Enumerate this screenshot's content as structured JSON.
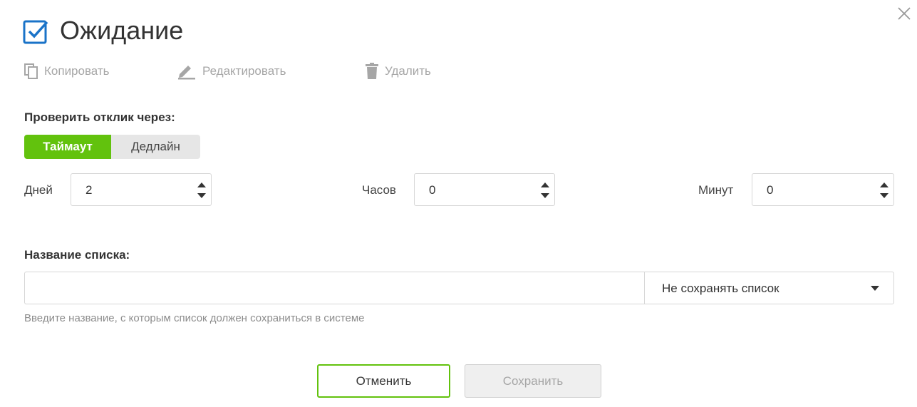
{
  "dialog": {
    "title": "Ожидание",
    "close_icon": "close-icon",
    "title_icon": "checkbox-checked-icon",
    "accent": "#62c20d",
    "brand_blue": "#1a73c8"
  },
  "toolbar": {
    "copy_label": "Копировать",
    "edit_label": "Редактировать",
    "delete_label": "Удалить"
  },
  "response_check": {
    "label": "Проверить отклик через:",
    "options": [
      "Таймаут",
      "Дедлайн"
    ],
    "selected": "Таймаут"
  },
  "timeout": {
    "days_label": "Дней",
    "days_value": "2",
    "hours_label": "Часов",
    "hours_value": "0",
    "minutes_label": "Минут",
    "minutes_value": "0"
  },
  "list_name": {
    "label": "Название списка:",
    "value": "",
    "select_value": "Не сохранять список",
    "hint": "Введите название, с которым список должен сохраниться в системе"
  },
  "actions": {
    "cancel_label": "Отменить",
    "save_label": "Сохранить"
  }
}
